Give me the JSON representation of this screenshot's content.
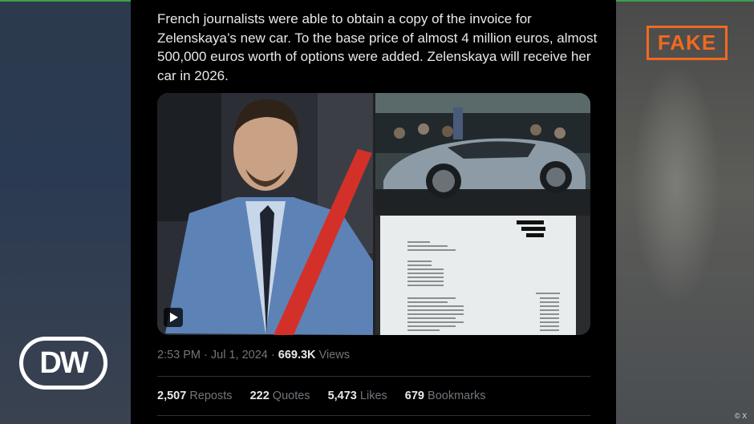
{
  "tweet": {
    "text": "French journalists were able to obtain a copy of the invoice for Zelenskaya’s new car. To the base price of almost 4 million euros, almost 500,000 euros worth of options were added. Zelenskaya will receive her car in 2026.",
    "time": "2:53 PM",
    "date": "Jul 1, 2024",
    "views_count": "669.3K",
    "views_label": "Views",
    "reposts_count": "2,507",
    "reposts_label": "Reposts",
    "quotes_count": "222",
    "quotes_label": "Quotes",
    "likes_count": "5,473",
    "likes_label": "Likes",
    "bookmarks_count": "679",
    "bookmarks_label": "Bookmarks"
  },
  "badge": {
    "label": "FAKE",
    "color": "#f06a1f"
  },
  "logo": {
    "label": "DW"
  },
  "credit": "© X",
  "invoice": {
    "total": "3,333,000.00",
    "lines": [
      "Exterior Colour - Black Carbon",
      "Interior Colour",
      "Titan Fuel Tank Style",
      "Assisted Reflector",
      "EB Logo Wheel Caps",
      "Brake Calipers",
      "Rear Signature Line",
      "Interior Trim Parts",
      "Bucket Seats"
    ]
  }
}
